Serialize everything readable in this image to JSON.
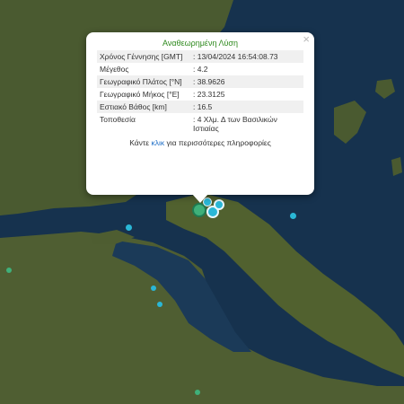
{
  "popup": {
    "title": "Αναθεωρημένη Λύση",
    "close_glyph": "×",
    "rows": [
      {
        "label": "Χρόνος Γέννησης [GMT]",
        "value": ": 13/04/2024 16:54:08.73"
      },
      {
        "label": "Μέγεθος",
        "value": ": 4.2"
      },
      {
        "label": "Γεωγραφικό Πλάτος [°N]",
        "value": ": 38.9626"
      },
      {
        "label": "Γεωγραφικό Μήκος [°E]",
        "value": ": 23.3125"
      },
      {
        "label": "Εστιακό Βάθος [km]",
        "value": ": 16.5"
      },
      {
        "label": "Τοποθεσία",
        "value": ": 4 Χλμ. Δ των Βασιλικών Ιστιαίας"
      }
    ],
    "footer_before": "Κάντε ",
    "footer_link": "κλικ",
    "footer_after": " για περισσότερες πληροφορίες"
  },
  "colors": {
    "sea": "#16324e",
    "land": "#4a5a30",
    "quake_recent": "#2ab7d6",
    "quake_older": "#3fb07a",
    "title_green": "#2f8a1e",
    "link_blue": "#1f6fc7"
  },
  "quake_markers": [
    {
      "name": "quake-marker-cluster",
      "color": "quake_recent"
    },
    {
      "name": "quake-marker-cluster-2",
      "color": "quake_older"
    },
    {
      "name": "quake-marker-cluster-3",
      "color": "quake_recent"
    },
    {
      "name": "quake-marker-cluster-4",
      "color": "quake_recent"
    },
    {
      "name": "quake-marker-east",
      "color": "quake_recent"
    },
    {
      "name": "quake-marker-north-gulf",
      "color": "quake_recent"
    },
    {
      "name": "quake-marker-west",
      "color": "quake_older"
    },
    {
      "name": "quake-marker-central",
      "color": "quake_recent"
    },
    {
      "name": "quake-marker-southwest",
      "color": "quake_recent"
    },
    {
      "name": "quake-marker-south",
      "color": "quake_older"
    }
  ]
}
